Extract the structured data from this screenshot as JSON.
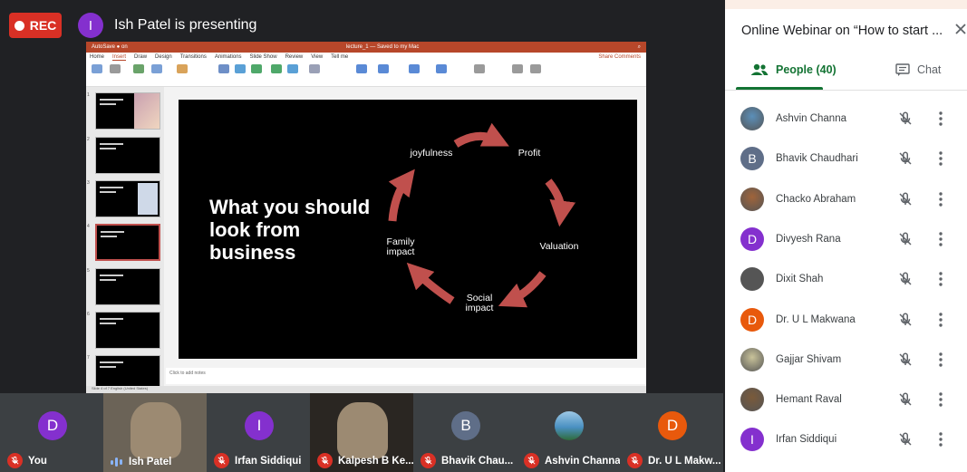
{
  "meeting": {
    "rec_label": "REC",
    "presenter_initial": "I",
    "presenter_text": "Ish Patel is presenting"
  },
  "ppt": {
    "title_left": "AutoSave ● on",
    "title_center": "lecture_1 — Saved to my Mac",
    "tabs": [
      "Home",
      "Insert",
      "Draw",
      "Design",
      "Transitions",
      "Animations",
      "Slide Show",
      "Review",
      "View",
      "Tell me"
    ],
    "active_tab": "Insert",
    "tabs_right": "Share  Comments",
    "notes_placeholder": "Click to add notes",
    "status_text": "Slide 4 of 7    English (United States)",
    "slide": {
      "heading": "What you should look from business",
      "cycle": {
        "top_left": "joyfulness",
        "top_right": "Profit",
        "right": "Valuation",
        "bottom": "Social impact",
        "left": "Family impact"
      }
    }
  },
  "filmstrip": [
    {
      "name": "You",
      "initial": "D",
      "color": "#8430ce",
      "mic": "off"
    },
    {
      "name": "Ish Patel",
      "initial": "",
      "color": "#6b6357",
      "mic": "speaking",
      "video": true
    },
    {
      "name": "Irfan Siddiqui",
      "initial": "I",
      "color": "#8430ce",
      "mic": "off"
    },
    {
      "name": "Kalpesh B Ke...",
      "initial": "",
      "color": "#2a2622",
      "mic": "off",
      "video": true
    },
    {
      "name": "Bhavik Chau...",
      "initial": "B",
      "color": "#5f6e88",
      "mic": "off"
    },
    {
      "name": "Ashvin Channa",
      "initial": "",
      "color": "#4a90c2",
      "mic": "off",
      "photo": true
    },
    {
      "name": "Dr. U L Makw...",
      "initial": "D",
      "color": "#e8590c",
      "mic": "off"
    }
  ],
  "panel": {
    "title": "Online Webinar on “How to start ...",
    "people_tab": "People (40)",
    "chat_tab": "Chat",
    "people": [
      {
        "name": "Ashvin Channa",
        "initial": "",
        "color": "#5b8fb9",
        "photo": true
      },
      {
        "name": "Bhavik Chaudhari",
        "initial": "B",
        "color": "#5f6e88"
      },
      {
        "name": "Chacko Abraham",
        "initial": "",
        "color": "#a0643a",
        "photo": true
      },
      {
        "name": "Divyesh Rana",
        "initial": "D",
        "color": "#8430ce"
      },
      {
        "name": "Dixit Shah",
        "initial": "",
        "color": "#555555",
        "photo": true
      },
      {
        "name": "Dr. U L Makwana",
        "initial": "D",
        "color": "#e8590c"
      },
      {
        "name": "Gajjar Shivam",
        "initial": "",
        "color": "#c9c39a",
        "photo": true
      },
      {
        "name": "Hemant Raval",
        "initial": "",
        "color": "#7a5a3a",
        "photo": true
      },
      {
        "name": "Irfan Siddiqui",
        "initial": "I",
        "color": "#8430ce"
      }
    ]
  },
  "colors": {
    "rec": "#d93025",
    "accent_green": "#137333",
    "slide_arrow": "#c0504d",
    "stage_bg": "#202124"
  }
}
